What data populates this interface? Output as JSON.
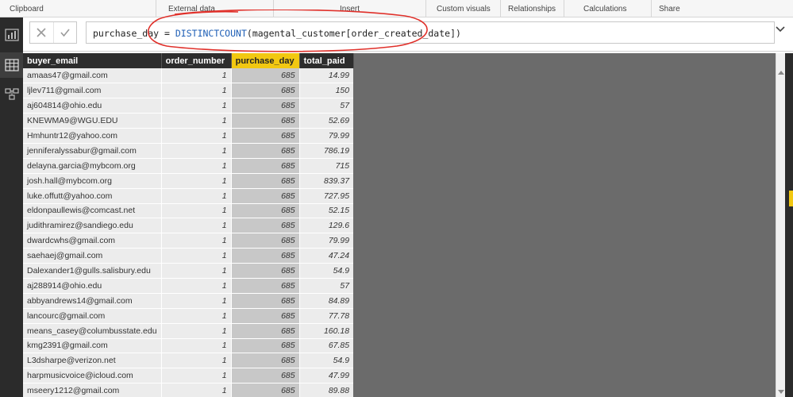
{
  "ribbon": {
    "groups": [
      {
        "label": "Clipboard"
      },
      {
        "label": "External data"
      },
      {
        "label": "Insert"
      },
      {
        "label": "Custom visuals"
      },
      {
        "label": "Relationships"
      },
      {
        "label": "Calculations"
      },
      {
        "label": "Share"
      }
    ]
  },
  "left_rail": {
    "items": [
      {
        "icon": "report-view-icon"
      },
      {
        "icon": "data-view-icon",
        "active": true
      },
      {
        "icon": "relationships-view-icon"
      }
    ]
  },
  "formula_bar": {
    "measure_name": "purchase_day",
    "equals": " = ",
    "function_name": "DISTINCTCOUNT",
    "argument": "(magental_customer[order_created_date])",
    "annotation_color": "#e0302a"
  },
  "table": {
    "columns": [
      "buyer_email",
      "order_number",
      "purchase_day",
      "total_paid"
    ],
    "selected_column": "purchase_day",
    "rows": [
      [
        "amaas47@gmail.com",
        "1",
        "685",
        "14.99"
      ],
      [
        "ljlev711@gmail.com",
        "1",
        "685",
        "150"
      ],
      [
        "aj604814@ohio.edu",
        "1",
        "685",
        "57"
      ],
      [
        "KNEWMA9@WGU.EDU",
        "1",
        "685",
        "52.69"
      ],
      [
        "Hmhuntr12@yahoo.com",
        "1",
        "685",
        "79.99"
      ],
      [
        "jenniferalyssabur@gmail.com",
        "1",
        "685",
        "786.19"
      ],
      [
        "delayna.garcia@mybcom.org",
        "1",
        "685",
        "715"
      ],
      [
        "josh.hall@mybcom.org",
        "1",
        "685",
        "839.37"
      ],
      [
        "luke.offutt@yahoo.com",
        "1",
        "685",
        "727.95"
      ],
      [
        "eldonpaullewis@comcast.net",
        "1",
        "685",
        "52.15"
      ],
      [
        "judithramirez@sandiego.edu",
        "1",
        "685",
        "129.6"
      ],
      [
        "dwardcwhs@gmail.com",
        "1",
        "685",
        "79.99"
      ],
      [
        "saehaej@gmail.com",
        "1",
        "685",
        "47.24"
      ],
      [
        "Dalexander1@gulls.salisbury.edu",
        "1",
        "685",
        "54.9"
      ],
      [
        "aj288914@ohio.edu",
        "1",
        "685",
        "57"
      ],
      [
        "abbyandrews14@gmail.com",
        "1",
        "685",
        "84.89"
      ],
      [
        "lancourc@gmail.com",
        "1",
        "685",
        "77.78"
      ],
      [
        "means_casey@columbusstate.edu",
        "1",
        "685",
        "160.18"
      ],
      [
        "kmg2391@gmail.com",
        "1",
        "685",
        "67.85"
      ],
      [
        "L3dsharpe@verizon.net",
        "1",
        "685",
        "54.9"
      ],
      [
        "harpmusicvoice@icloud.com",
        "1",
        "685",
        "47.99"
      ],
      [
        "mseery1212@gmail.com",
        "1",
        "685",
        "89.88"
      ]
    ]
  },
  "colors": {
    "selected_header": "#f2c811",
    "header_bg": "#2d2d2d",
    "canvas_bg": "#6b6b6b",
    "rail_bg": "#2b2b2b"
  }
}
